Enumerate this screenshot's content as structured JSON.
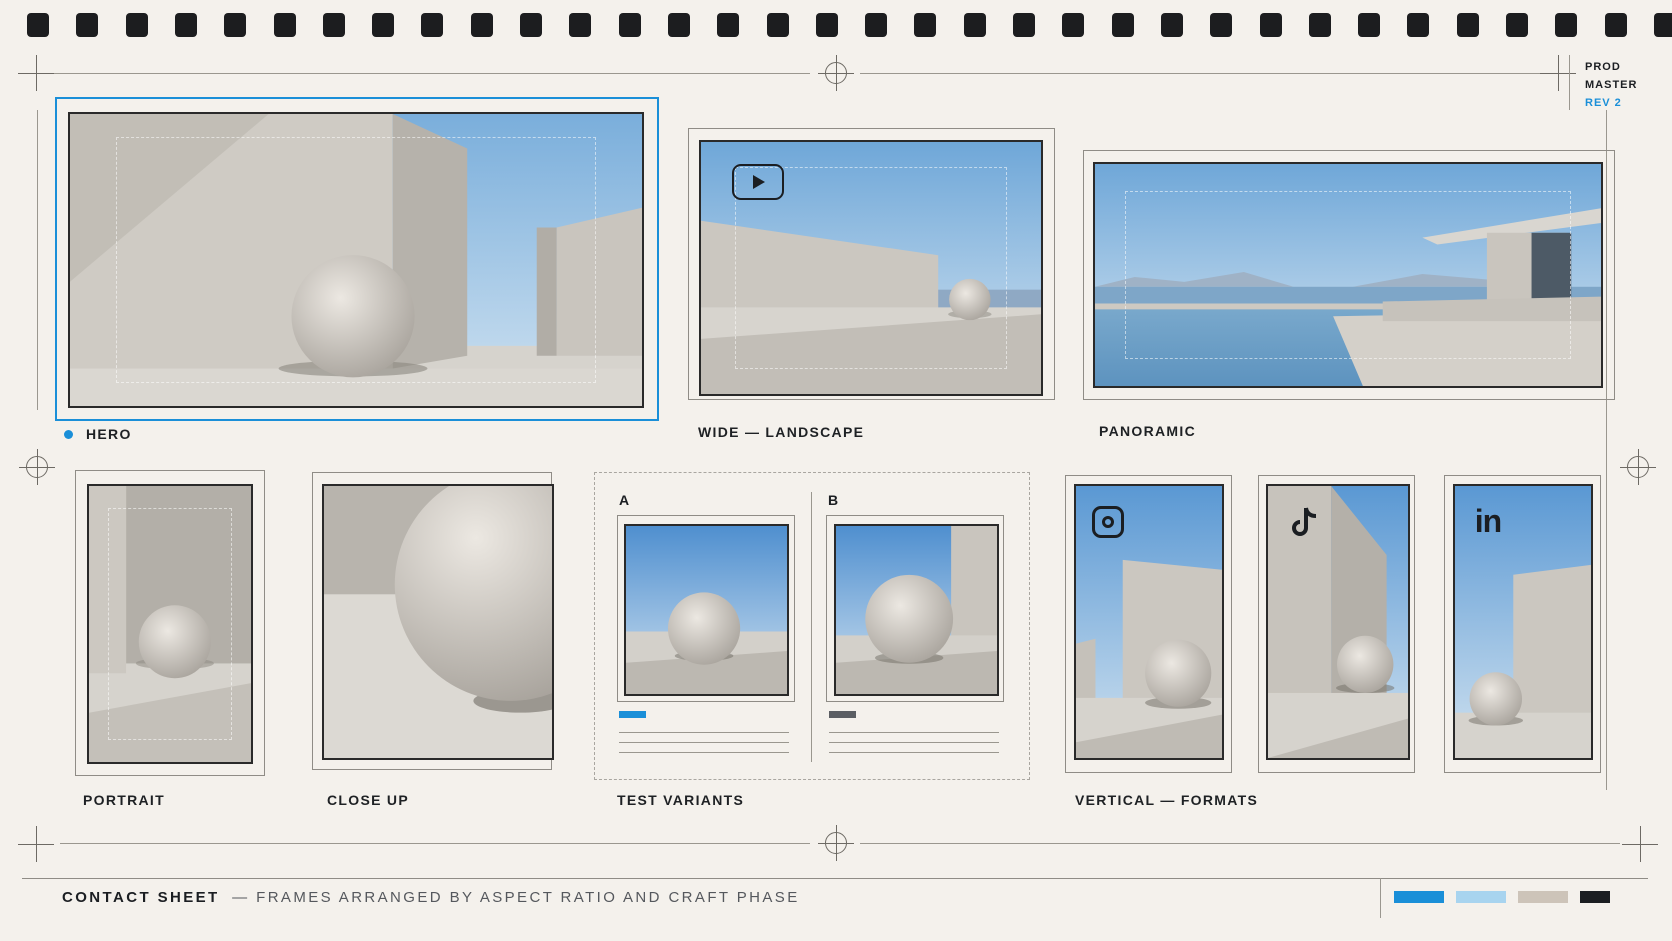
{
  "revision": {
    "line1": "PROD",
    "line2": "MASTER",
    "line3": "REV 2"
  },
  "frames": {
    "hero": "HERO",
    "wide": "WIDE — LANDSCAPE",
    "panoramic": "PANORAMIC",
    "portrait": "PORTRAIT",
    "close_up": "CLOSE UP",
    "test_variants": "TEST VARIANTS",
    "vertical": "VERTICAL — FORMATS"
  },
  "variants": {
    "a": "A",
    "b": "B"
  },
  "platform_icons": [
    "play-icon",
    "instagram-icon",
    "tiktok-icon",
    "linkedin-icon"
  ],
  "footer": {
    "title": "CONTACT SHEET",
    "subtitle": "— FRAMES ARRANGED BY ASPECT RATIO AND CRAFT PHASE"
  },
  "palette": [
    "#1a8fd8",
    "#a8d4ef",
    "#cdc4b9",
    "#1b1e22"
  ],
  "colors": {
    "accent": "#1a8fd8",
    "background": "#f4f1ec",
    "ink": "#1b1e22"
  }
}
